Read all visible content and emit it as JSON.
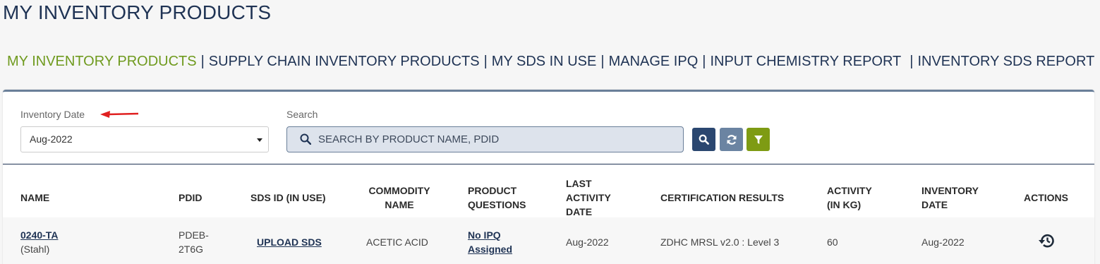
{
  "page": {
    "title": "MY INVENTORY PRODUCTS"
  },
  "subnav": {
    "items": [
      "MY INVENTORY PRODUCTS",
      "SUPPLY CHAIN INVENTORY PRODUCTS",
      "MY SDS IN USE",
      "MANAGE IPQ",
      "INPUT CHEMISTRY REPORT",
      "INVENTORY SDS REPORT"
    ],
    "separator": "|"
  },
  "filters": {
    "inventory_date_label": "Inventory Date",
    "inventory_date_value": "Aug-2022",
    "search_label": "Search",
    "search_placeholder": "SEARCH BY PRODUCT NAME, PDID"
  },
  "colors": {
    "accent_green": "#6f9a1e",
    "navy": "#1f3354",
    "arrow": "#e02020"
  },
  "table": {
    "headers": {
      "name": "NAME",
      "pdid": "PDID",
      "sds_id": "SDS ID (IN USE)",
      "commodity": "COMMODITY\nNAME",
      "questions": "PRODUCT\nQUESTIONS",
      "last_activity": "LAST\nACTIVITY\nDATE",
      "certification": "CERTIFICATION RESULTS",
      "activity": "ACTIVITY\n(IN KG)",
      "inventory_date": "INVENTORY\nDATE",
      "actions": "ACTIONS"
    },
    "rows": [
      {
        "name": "0240-TA",
        "supplier": "(Stahl)",
        "pdid_line1": "PDEB-",
        "pdid_line2": "2T6G",
        "sds": "UPLOAD SDS",
        "commodity": "ACETIC ACID",
        "questions_line1": "No IPQ",
        "questions_line2": "Assigned",
        "last_activity": "Aug-2022",
        "certification": "ZDHC MRSL v2.0 : Level 3",
        "activity": "60",
        "inventory_date": "Aug-2022",
        "action_icon": "history-icon"
      }
    ]
  }
}
